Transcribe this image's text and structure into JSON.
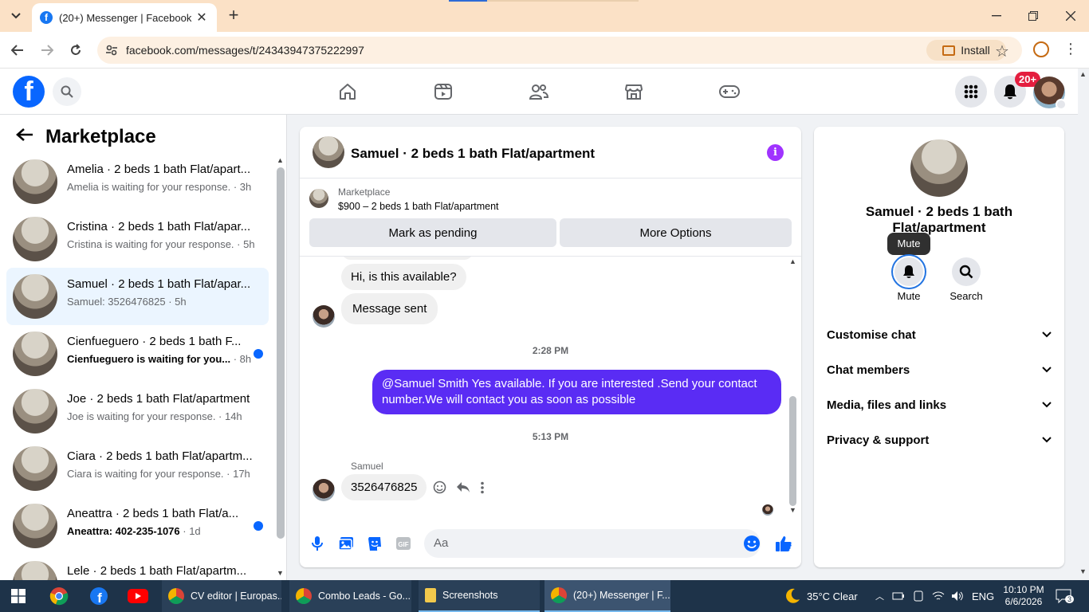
{
  "browser": {
    "tab_title": "(20+) Messenger | Facebook",
    "url": "facebook.com/messages/t/24343947375222997",
    "install_label": "Install"
  },
  "fb": {
    "notif_badge": "20+"
  },
  "left": {
    "title": "Marketplace",
    "conversations": [
      {
        "name": "Amelia · 2 beds 1 bath Flat/apart...",
        "sub": "Amelia is waiting for your response. · 3h",
        "unread": false,
        "active": false
      },
      {
        "name": "Cristina · 2 beds 1 bath Flat/apar...",
        "sub": "Cristina is waiting for your response. · 5h",
        "unread": false,
        "active": false
      },
      {
        "name": "Samuel · 2 beds 1 bath Flat/apar...",
        "sub": "Samuel: 3526476825 · 5h",
        "unread": false,
        "active": true
      },
      {
        "name": "Cienfueguero · 2 beds 1 bath F...",
        "sub": "Cienfueguero is waiting for you...",
        "time": " · 8h",
        "unread": true,
        "active": false
      },
      {
        "name": "Joe · 2 beds 1 bath Flat/apartment",
        "sub": "Joe is waiting for your response. · 14h",
        "unread": false,
        "active": false
      },
      {
        "name": "Ciara · 2 beds 1 bath Flat/apartm...",
        "sub": "Ciara is waiting for your response. · 17h",
        "unread": false,
        "active": false
      },
      {
        "name": "Aneattra · 2 beds 1 bath Flat/a...",
        "sub": "Aneattra: 402-235-1076",
        "time": " · 1d",
        "unread": true,
        "active": false
      },
      {
        "name": "Lele · 2 beds 1 bath Flat/apartm...",
        "sub": "",
        "unread": false,
        "active": false
      }
    ]
  },
  "chat": {
    "title": "Samuel · 2 beds 1 bath Flat/apartment",
    "marketplace_label": "Marketplace",
    "listing": "$900 – 2 beds 1 bath Flat/apartment",
    "mark_pending": "Mark as pending",
    "more_options": "More Options",
    "msg1": "Hi, is this available?",
    "msg2": "Message sent",
    "time1": "2:28 PM",
    "reply": "@Samuel Smith Yes available. If you are interested .Send your contact number.We will contact you as soon as possible",
    "time2": "5:13 PM",
    "sender": "Samuel",
    "msg3": "3526476825",
    "input_placeholder": "Aa"
  },
  "info": {
    "name": "Samuel · 2 beds 1 bath Flat/apartment",
    "tooltip": "Mute",
    "mute_label": "Mute",
    "search_label": "Search",
    "sections": [
      "Customise chat",
      "Chat members",
      "Media, files and links",
      "Privacy & support"
    ]
  },
  "taskbar": {
    "apps": [
      "CV editor | Europas...",
      "Combo Leads - Go...",
      "Screenshots",
      "(20+) Messenger | F..."
    ],
    "weather": "35°C  Clear",
    "lang": "ENG",
    "time": "10:10 PM",
    "date": "6/6/2026",
    "notif_count": "3"
  },
  "colors": {
    "fb_blue": "#0866ff",
    "outgoing_bubble": "#5a2cf4",
    "active_conv": "#ebf5ff",
    "unread_dot": "#0866ff"
  }
}
